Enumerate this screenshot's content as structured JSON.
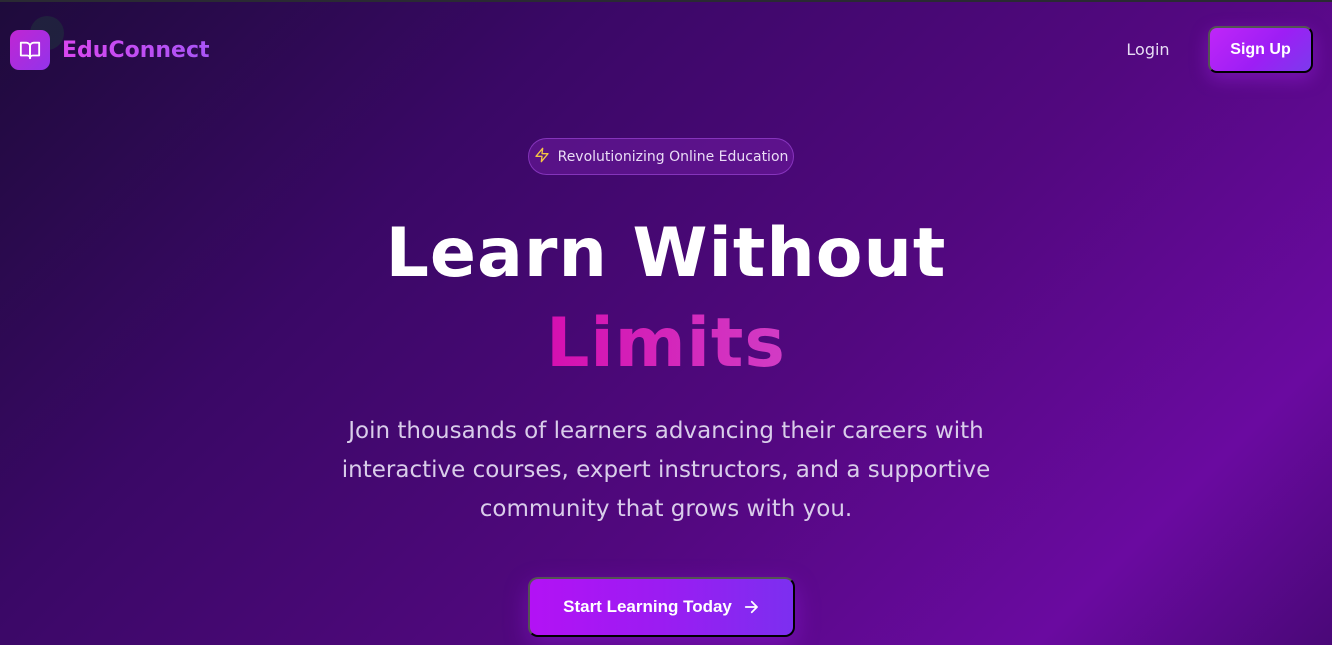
{
  "brand": {
    "name": "EduConnect",
    "icon": "book-open-icon",
    "colors": {
      "gradient_start": "#d946ef",
      "gradient_end": "#a855f7"
    }
  },
  "nav": {
    "login_label": "Login",
    "signup_label": "Sign Up"
  },
  "hero": {
    "badge": {
      "icon": "lightning-icon",
      "text": "Revolutionizing Online Education"
    },
    "title_line1": "Learn Without",
    "title_line2": "Limits",
    "subtitle": "Join thousands of learners advancing their careers with interactive courses, expert instructors, and a supportive community that grows with you.",
    "cta": {
      "label": "Start Learning Today",
      "icon": "arrow-right-icon"
    }
  },
  "colors": {
    "background_start": "#1e0b3b",
    "background_end": "#6a0aa0",
    "accent_magenta": "#d81bb8",
    "button_purple": "#b312f5",
    "badge_icon": "#f5c542"
  }
}
